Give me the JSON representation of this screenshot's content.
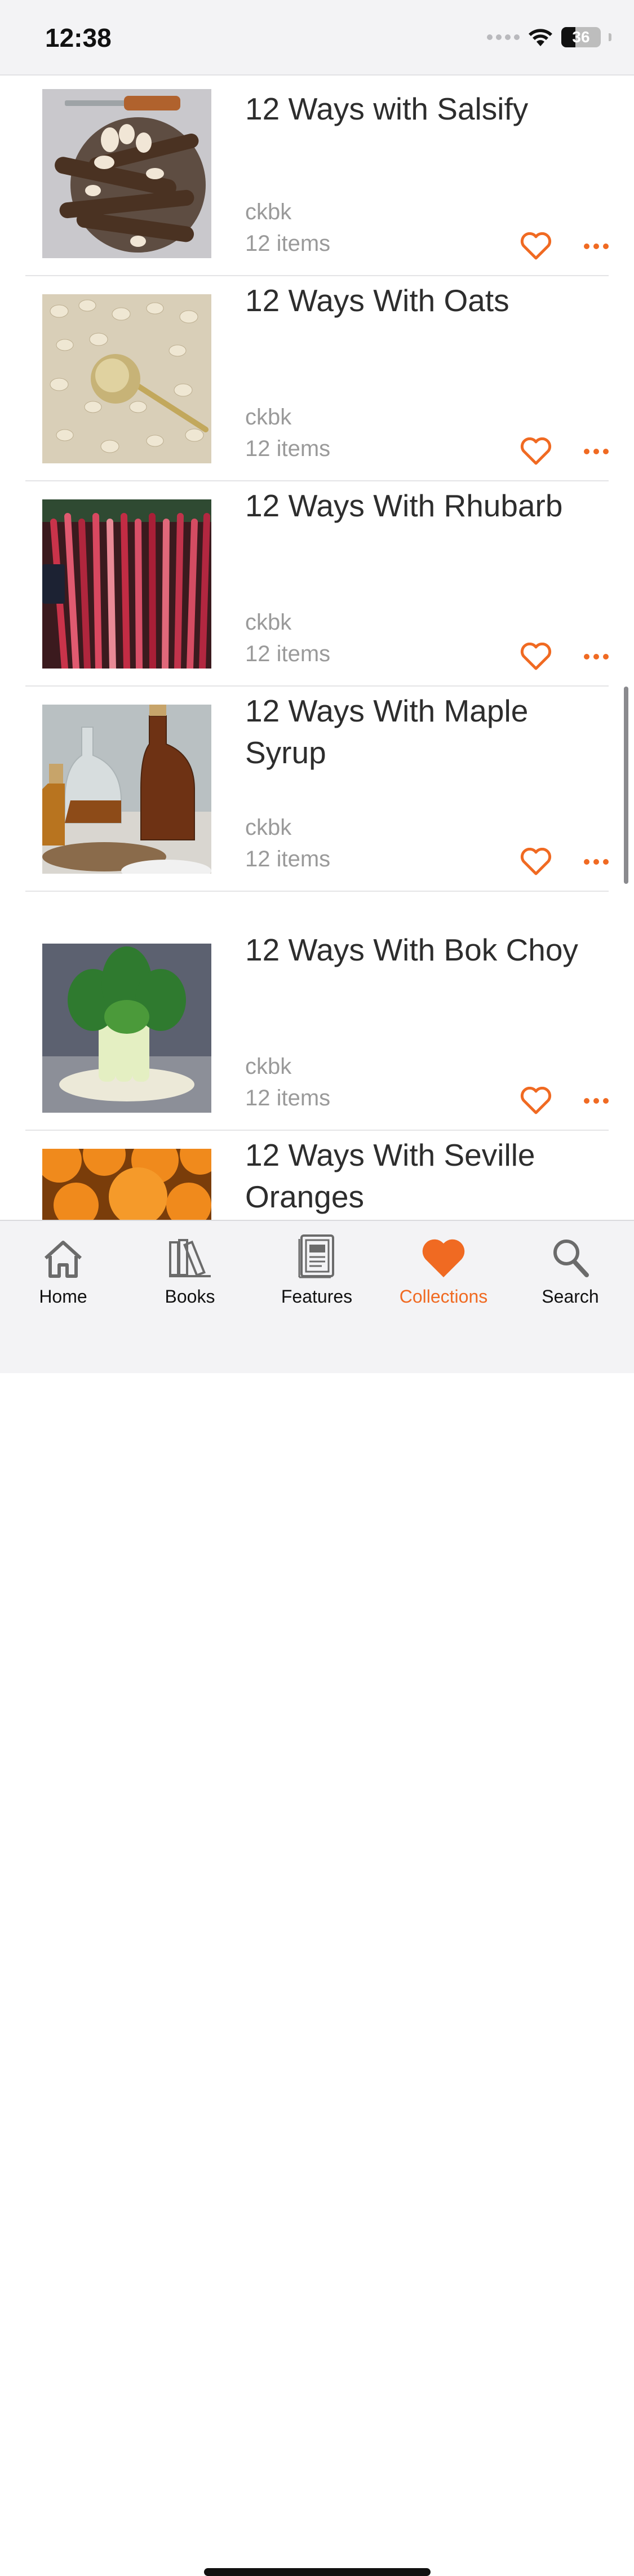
{
  "status": {
    "time": "12:38",
    "battery": "36"
  },
  "collections": [
    {
      "title": "12 Ways with Salsify",
      "author": "ckbk",
      "count": "12 items"
    },
    {
      "title": "12 Ways With Oats",
      "author": "ckbk",
      "count": "12 items"
    },
    {
      "title": "12 Ways With Rhubarb",
      "author": "ckbk",
      "count": "12 items"
    },
    {
      "title": "12 Ways With Maple Syrup",
      "author": "ckbk",
      "count": "12 items"
    },
    {
      "title": "12 Ways With Bok Choy",
      "author": "ckbk",
      "count": "12 items"
    },
    {
      "title": "12 Ways With Seville Oranges",
      "author": "",
      "count": ""
    }
  ],
  "tabbar": {
    "home": "Home",
    "books": "Books",
    "features": "Features",
    "collections": "Collections",
    "search": "Search",
    "active": "collections"
  },
  "colors": {
    "accent": "#f06a22",
    "text": "#2d2d2d",
    "muted": "#9a9a9a"
  },
  "icons": [
    "wifi-icon",
    "battery-icon",
    "heart-outline-icon",
    "more-dots-icon",
    "home-icon",
    "books-icon",
    "features-icon",
    "heart-filled-icon",
    "search-icon"
  ]
}
